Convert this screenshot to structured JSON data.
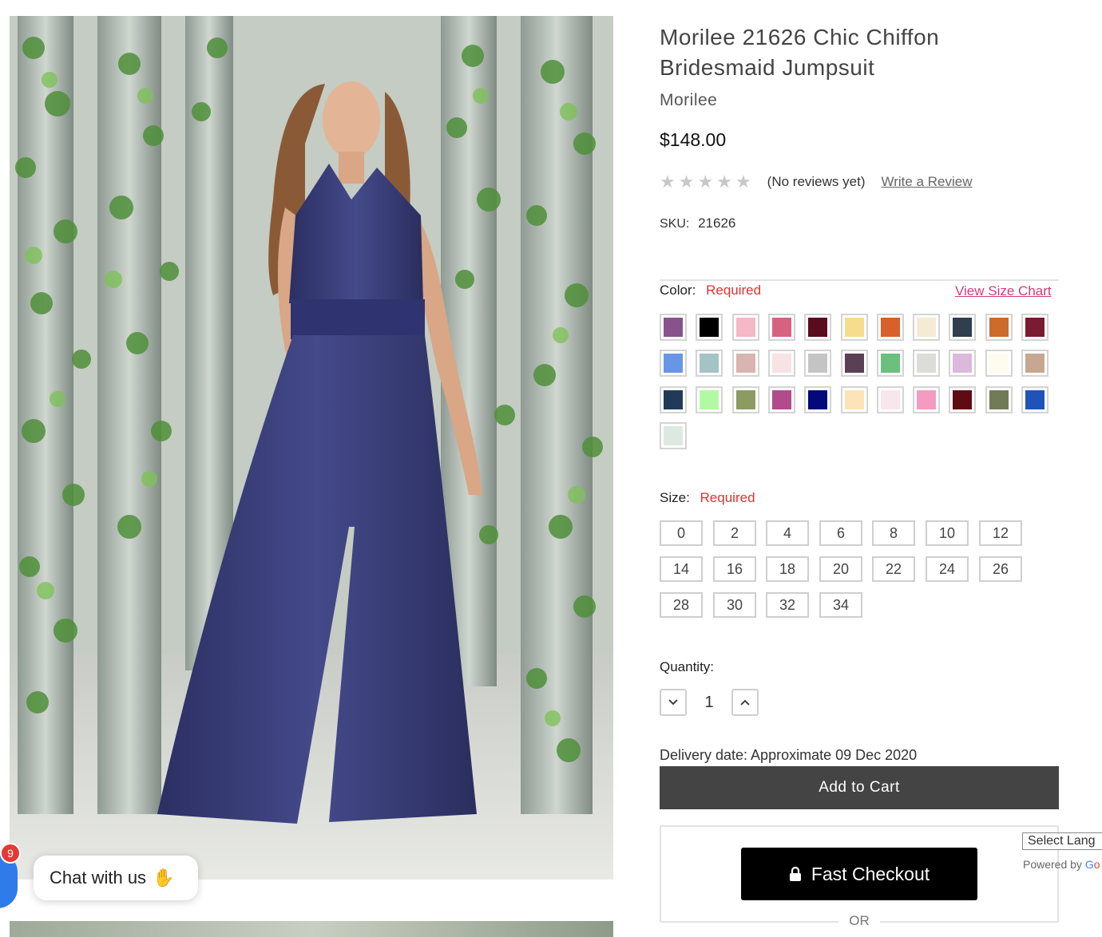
{
  "product": {
    "title": "Morilee 21626 Chic Chiffon Bridesmaid Jumpsuit",
    "brand": "Morilee",
    "price": "$148.00",
    "rating_stars": 0,
    "reviews_text": "(No reviews yet)",
    "write_review_label": "Write a Review",
    "sku_label": "SKU:",
    "sku_value": "21626"
  },
  "color_option": {
    "label": "Color:",
    "required_text": "Required",
    "size_chart_label": "View Size Chart",
    "swatches": [
      "#86538c",
      "#000000",
      "#f4b8c6",
      "#d5637f",
      "#5a0c1e",
      "#f5dc8e",
      "#d8602a",
      "#f4ead6",
      "#2f3f4d",
      "#cc6b2c",
      "#7a1b33",
      "#6796e6",
      "#a4c3c6",
      "#d9b4b0",
      "#f7e3e4",
      "#c4c4c4",
      "#5a3f55",
      "#6cc07e",
      "#dcdcd8",
      "#dcb9dc",
      "#fdfcee",
      "#c6a890",
      "#213a57",
      "#b2f9a4",
      "#8b9b62",
      "#b24b8b",
      "#01097b",
      "#fde4b7",
      "#f7e6ec",
      "#f49bc2",
      "#5f0b12",
      "#717c57",
      "#1f53ba",
      "#dce9e0"
    ]
  },
  "size_option": {
    "label": "Size:",
    "required_text": "Required",
    "sizes": [
      "0",
      "2",
      "4",
      "6",
      "8",
      "10",
      "12",
      "14",
      "16",
      "18",
      "20",
      "22",
      "24",
      "26",
      "28",
      "30",
      "32",
      "34"
    ]
  },
  "quantity": {
    "label": "Quantity:",
    "value": "1",
    "decrease_icon": "chevron-down-icon",
    "increase_icon": "chevron-up-icon"
  },
  "delivery_text": "Delivery date: Approximate 09 Dec 2020",
  "add_to_cart_label": "Add to Cart",
  "fast_checkout": {
    "label": "Fast Checkout",
    "icon": "lock-icon"
  },
  "or_label": "OR",
  "translate": {
    "select_label": "Select Lang",
    "powered_by": "Powered by",
    "google_g": "G",
    "google_o": "o"
  },
  "chat": {
    "badge_count": "9",
    "label": "Chat with us",
    "icon": "waving-hand-icon"
  }
}
